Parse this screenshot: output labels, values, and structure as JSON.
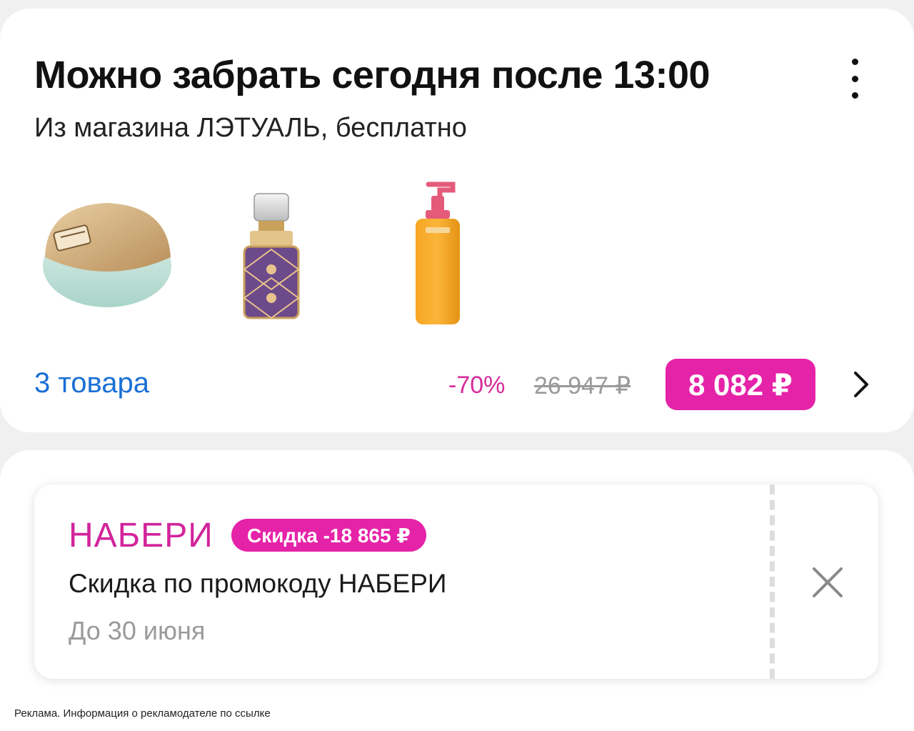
{
  "order": {
    "title": "Можно забрать сегодня после 13:00",
    "subtitle": "Из магазина ЛЭТУАЛЬ, бесплатно",
    "menu_icon": "kebab-vertical-icon",
    "products": [
      {
        "image": "perfume-round-wooden-cap"
      },
      {
        "image": "perfume-bottle-ornate"
      },
      {
        "image": "pump-bottle-orange"
      }
    ],
    "items_count": "3 товара",
    "discount_percent": "-70%",
    "old_price": "26 947 ₽",
    "price": "8 082 ₽",
    "chevron_icon": "chevron-right-icon",
    "colors": {
      "accent": "#e523a8",
      "link": "#1a6fd6",
      "discount": "#d62c9a"
    }
  },
  "promo": {
    "code": "НАБЕРИ",
    "badge": "Скидка -18 865 ₽",
    "description": "Скидка по промокоду НАБЕРИ",
    "valid_until": "До 30 июня",
    "close_icon": "close-icon"
  },
  "ad_note": "Реклама. Информация о рекламодателе по ссылке"
}
